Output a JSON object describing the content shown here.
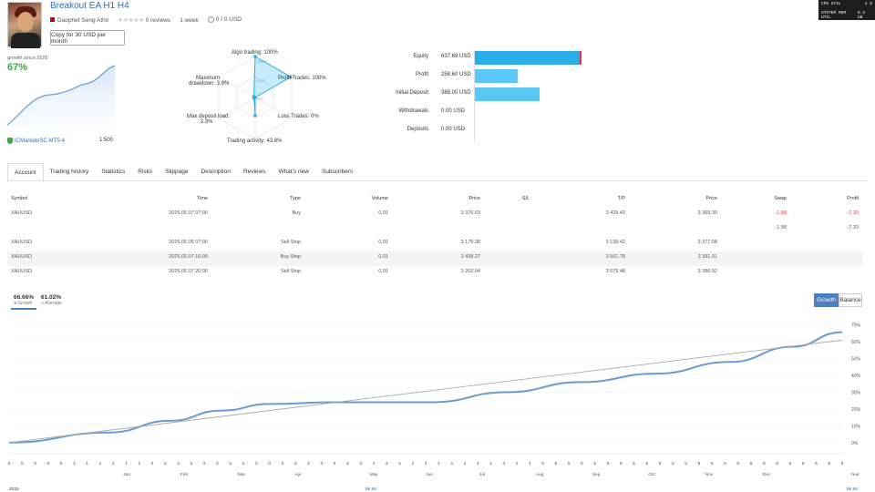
{
  "header": {
    "title": "Breakout EA H1 H4",
    "author": "Daophet Seng Athit",
    "reviews": "0 reviews",
    "age": "1 week",
    "balance_text": "0 / 0 USD",
    "copy_button": "Copy for 30 USD per month"
  },
  "sysmon": {
    "cpu_label": "CPU UTIL",
    "cpu_value": "4 %",
    "mem_label": "SYSTEM MEM UTIL",
    "mem_value": "6.2 GB"
  },
  "growth": {
    "since_label": "growth since 2025",
    "value": "67%",
    "broker": "ICMarketsSC-MT5-4",
    "leverage": "1:500"
  },
  "radar": {
    "algo": "Algo trading: 100%",
    "profit_trades": "Profit Trades: 100%",
    "loss_trades": "Loss Trades: 0%",
    "activity": "Trading activity: 43.8%",
    "deposit_load_line1": "Max deposit load:",
    "deposit_load_line2": "3.3%",
    "drawdown_line1": "Maximum",
    "drawdown_line2": "drawdown: 3.9%",
    "scale_100": "100%",
    "scale_50": "50%",
    "scale_0": "0%",
    "values": {
      "algo": 1.0,
      "profit": 1.0,
      "loss": 0.0,
      "activity": 0.438,
      "deposit_load": 0.033,
      "drawdown": 0.039
    }
  },
  "bars": {
    "items": [
      {
        "label": "Equity",
        "value": "637.69 USD",
        "amount": 637.69
      },
      {
        "label": "Profit",
        "value": "258.60 USD",
        "amount": 258.6
      },
      {
        "label": "Initial Deposit",
        "value": "388.00 USD",
        "amount": 388.0
      },
      {
        "label": "Withdrawals",
        "value": "0.00 USD",
        "amount": 0
      },
      {
        "label": "Deposits",
        "value": "0.00 USD",
        "amount": 0
      }
    ],
    "color": "#5ac8f5",
    "equity_color": "#2aaee8",
    "marker_color": "#e0314b"
  },
  "tabs": [
    "Account",
    "Trading history",
    "Statistics",
    "Risks",
    "Slippage",
    "Description",
    "Reviews",
    "What's new",
    "Subscribers"
  ],
  "table": {
    "headers": [
      "Symbol",
      "Time",
      "Type",
      "Volume",
      "Price",
      "S/L",
      "T/P",
      "Price",
      "Swap",
      "Profit"
    ],
    "rows": [
      {
        "symbol": "XAUUSD",
        "time": "2025.05.07 07:00",
        "type": "Buy",
        "volume": "0.01",
        "price": "3 376.63",
        "sl": "",
        "tp": "3 429.43",
        "price2": "3 369.30",
        "swap": "-1.58",
        "profit": "-7.33",
        "alt": false,
        "neg": true
      },
      {
        "symbol": "",
        "time": "",
        "type": "",
        "volume": "",
        "price": "",
        "sl": "",
        "tp": "",
        "price2": "",
        "swap": "-1.58",
        "profit": "-7.33",
        "alt": false,
        "neg": false
      },
      {
        "symbol": "XAUUSD",
        "time": "2025.05.05 07:00",
        "type": "Sell Stop",
        "volume": "0.01",
        "price": "3 179.38",
        "sl": "",
        "tp": "3 128.42",
        "price2": "3 377.08",
        "swap": "",
        "profit": "",
        "alt": false,
        "neg": false
      },
      {
        "symbol": "XAUUSD",
        "time": "2025.05.07 16:00",
        "type": "Buy Stop",
        "volume": "0.01",
        "price": "3 438.27",
        "sl": "",
        "tp": "3 561.78",
        "price2": "3 391.01",
        "swap": "",
        "profit": "",
        "alt": true,
        "neg": false
      },
      {
        "symbol": "XAUUSD",
        "time": "2025.05.07 20:00",
        "type": "Sell Stop",
        "volume": "0.01",
        "price": "3 202.04",
        "sl": "",
        "tp": "3 079.48",
        "price2": "3 386.92",
        "swap": "",
        "profit": "",
        "alt": false,
        "neg": false
      }
    ]
  },
  "chart_legend": {
    "growth_value": "66.66%",
    "growth_label": "Growth",
    "average_value": "61.02%",
    "average_label": "Average",
    "btn_growth": "Growth",
    "btn_balance": "Balance"
  },
  "chart_data": {
    "type": "line",
    "y_tick_labels": [
      "70%",
      "60%",
      "50%",
      "40%",
      "30%",
      "20%",
      "10%",
      "0%"
    ],
    "ylim": [
      -5,
      72
    ],
    "x_counts": [
      "0",
      "0",
      "0",
      "0",
      "0",
      "1",
      "1",
      "1",
      "1",
      "1",
      "1",
      "2",
      "2",
      "2",
      "2",
      "2",
      "2",
      "2",
      "2",
      "2",
      "3",
      "3",
      "3",
      "3",
      "3",
      "3",
      "3",
      "3",
      "4",
      "4",
      "4",
      "4",
      "4",
      "4",
      "4",
      "4",
      "4",
      "4",
      "4",
      "4",
      "4",
      "5",
      "5",
      "5",
      "5",
      "5",
      "5",
      "5",
      "5",
      "5",
      "5",
      "5",
      "5",
      "5",
      "5",
      "6",
      "6",
      "6",
      "6",
      "6",
      "6",
      "6",
      "6",
      "6",
      "6"
    ],
    "month_labels": [
      "Jan",
      "Feb",
      "Mar",
      "Apr",
      "May",
      "Jun",
      "Jul",
      "Aug",
      "Sep",
      "Oct",
      "Nov",
      "Dec",
      "Year"
    ],
    "year_label": "2025",
    "bottom_values": [
      "66.66",
      "66.66"
    ],
    "series": [
      {
        "name": "Growth",
        "color": "#6b9bd2",
        "x": [
          0,
          8,
          13,
          17,
          21,
          26,
          30,
          34,
          40,
          46,
          52,
          58,
          63,
          67
        ],
        "y": [
          0,
          6,
          13,
          19,
          23,
          24,
          24,
          24,
          30,
          36,
          41,
          48,
          57,
          65.7
        ]
      },
      {
        "name": "Average",
        "color": "#aaaaaa",
        "x": [
          0,
          67
        ],
        "y": [
          0,
          61.02
        ]
      }
    ]
  }
}
